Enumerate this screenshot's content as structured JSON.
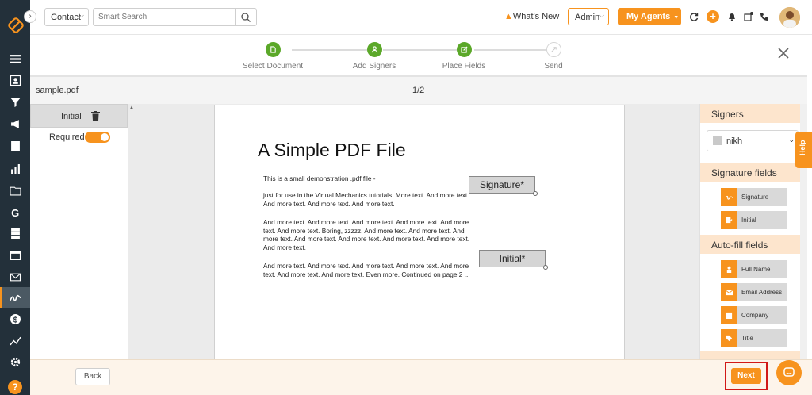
{
  "topbar": {
    "contact_label": "Contact",
    "search_placeholder": "Smart Search",
    "whats_new": "What's New",
    "admin_label": "Admin",
    "agents_label": "My Agents"
  },
  "stepper": {
    "steps": [
      {
        "label": "Select Document",
        "status": "done"
      },
      {
        "label": "Add Signers",
        "status": "done"
      },
      {
        "label": "Place Fields",
        "status": "done"
      },
      {
        "label": "Send",
        "status": "pending"
      }
    ]
  },
  "document": {
    "filename": "sample.pdf",
    "page_indicator": "1/2",
    "title": "A Simple PDF File",
    "paragraphs": [
      "This is a small demonstration .pdf file -",
      "just for use in the Virtual Mechanics tutorials. More text. And more text. And more text. And more text. And more text.",
      "And more text. And more text. And more text. And more text. And more text. And more text. Boring, zzzzz. And more text. And more text. And more text. And more text. And more text. And more text. And more text. And more text.",
      "And more text. And more text. And more text. And more text. And more text. And more text. And more text. Even more. Continued on page 2 ..."
    ]
  },
  "placed_fields": {
    "signature": "Signature*",
    "initial": "Initial*"
  },
  "properties": {
    "field_name": "Initial",
    "required_label": "Required",
    "required_on": true
  },
  "right_panel": {
    "signers_title": "Signers",
    "selected_signer": "nikh",
    "signature_fields_title": "Signature fields",
    "signature_fields": [
      "Signature",
      "Initial"
    ],
    "autofill_title": "Auto-fill fields",
    "autofill_fields": [
      "Full Name",
      "Email Address",
      "Company",
      "Title"
    ]
  },
  "help_tab": "Help",
  "footer": {
    "back_label": "Back",
    "next_label": "Next"
  },
  "colors": {
    "accent": "#f7931e",
    "sidebar": "#23303a",
    "step_done": "#5ba829",
    "highlight_box": "#d11818"
  }
}
